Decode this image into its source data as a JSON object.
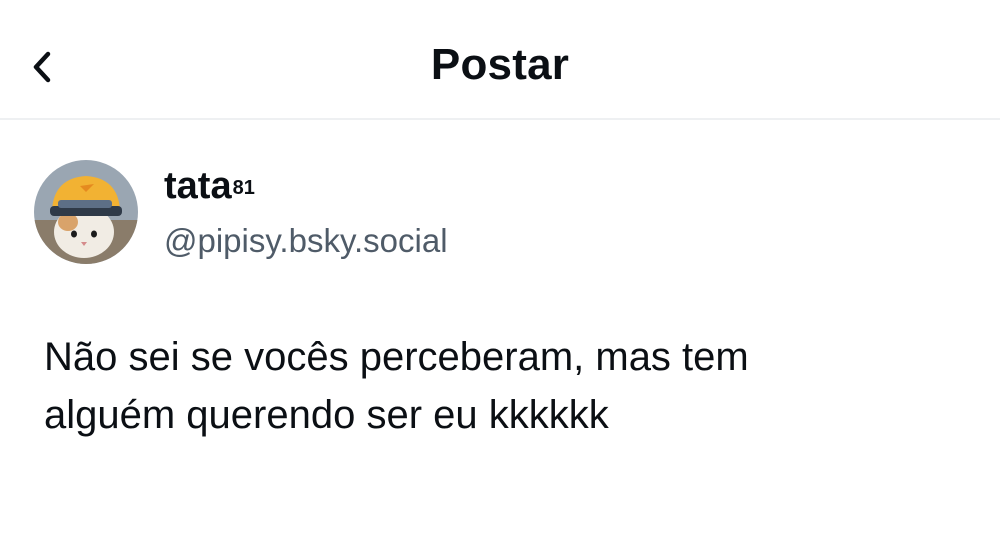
{
  "header": {
    "title": "Postar",
    "back_icon": "chevron-left-icon"
  },
  "post": {
    "author": {
      "display_name": "tata",
      "display_name_superscript": "81",
      "handle": "@pipisy.bsky.social",
      "avatar": "cat-with-helmet-avatar"
    },
    "text": "Não sei se vocês perceberam, mas tem\nalguém querendo ser eu kkkkkk"
  },
  "colors": {
    "text": "#0b0f14",
    "handle": "#4f5b68",
    "divider": "#eef0f2",
    "background": "#ffffff"
  }
}
